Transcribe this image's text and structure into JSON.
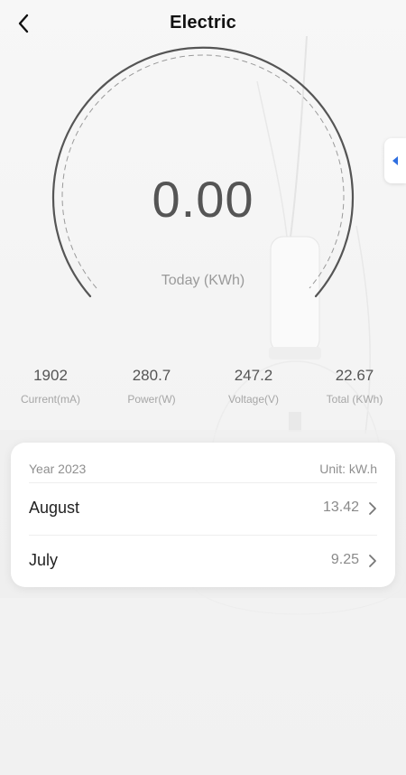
{
  "header": {
    "title": "Electric"
  },
  "gauge": {
    "value": "0.00",
    "label": "Today (KWh)"
  },
  "stats": [
    {
      "value": "1902",
      "label": "Current(mA)"
    },
    {
      "value": "280.7",
      "label": "Power(W)"
    },
    {
      "value": "247.2",
      "label": "Voltage(V)"
    },
    {
      "value": "22.67",
      "label": "Total (KWh)"
    }
  ],
  "monthly": {
    "year_label": "Year 2023",
    "unit_label": "Unit: kW.h",
    "rows": [
      {
        "month": "August",
        "value": "13.42"
      },
      {
        "month": "July",
        "value": "9.25"
      }
    ]
  },
  "icons": {
    "back": "chevron-left-icon",
    "side_tab": "triangle-left-icon",
    "row_arrow": "chevron-right-icon"
  },
  "colors": {
    "side_tab_arrow": "#2f6fe0",
    "gauge_arc": "#555555"
  }
}
